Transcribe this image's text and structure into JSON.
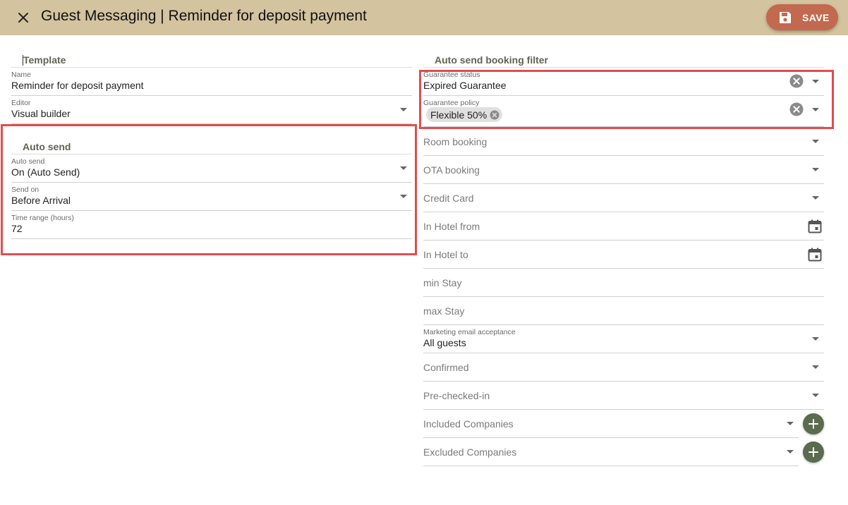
{
  "header": {
    "title": "Guest Messaging | Reminder for deposit payment",
    "save_label": "SAVE"
  },
  "template": {
    "title": "Template",
    "name_label": "Name",
    "name_value": "Reminder for deposit payment",
    "editor_label": "Editor",
    "editor_value": "Visual builder"
  },
  "auto_send": {
    "title": "Auto send",
    "auto_send_label": "Auto send",
    "auto_send_value": "On (Auto Send)",
    "send_on_label": "Send on",
    "send_on_value": "Before Arrival",
    "time_range_label": "Time range (hours)",
    "time_range_value": "72"
  },
  "filter": {
    "title": "Auto send booking filter",
    "guarantee_status_label": "Guarantee status",
    "guarantee_status_value": "Expired Guarantee",
    "guarantee_policy_label": "Guarantee policy",
    "guarantee_policy_chip": "Flexible 50%",
    "room_booking": "Room booking",
    "ota_booking": "OTA booking",
    "credit_card": "Credit Card",
    "in_hotel_from": "In Hotel from",
    "in_hotel_to": "In Hotel to",
    "min_stay": "min Stay",
    "max_stay": "max Stay",
    "marketing_label": "Marketing email acceptance",
    "marketing_value": "All guests",
    "confirmed": "Confirmed",
    "pre_checked_in": "Pre-checked-in",
    "included_companies": "Included Companies",
    "excluded_companies": "Excluded Companies"
  },
  "colors": {
    "header_bg": "#d3c39f",
    "save_button": "#c2694f",
    "section_title": "#5f6451",
    "add_button": "#5a6b4e",
    "highlight": "#e24d4d"
  },
  "icons": {
    "close": "close-icon",
    "save": "floppy-disk-icon",
    "dropdown": "chevron-down-icon",
    "clear": "clear-circle-icon",
    "calendar": "calendar-icon",
    "add": "plus-icon"
  }
}
